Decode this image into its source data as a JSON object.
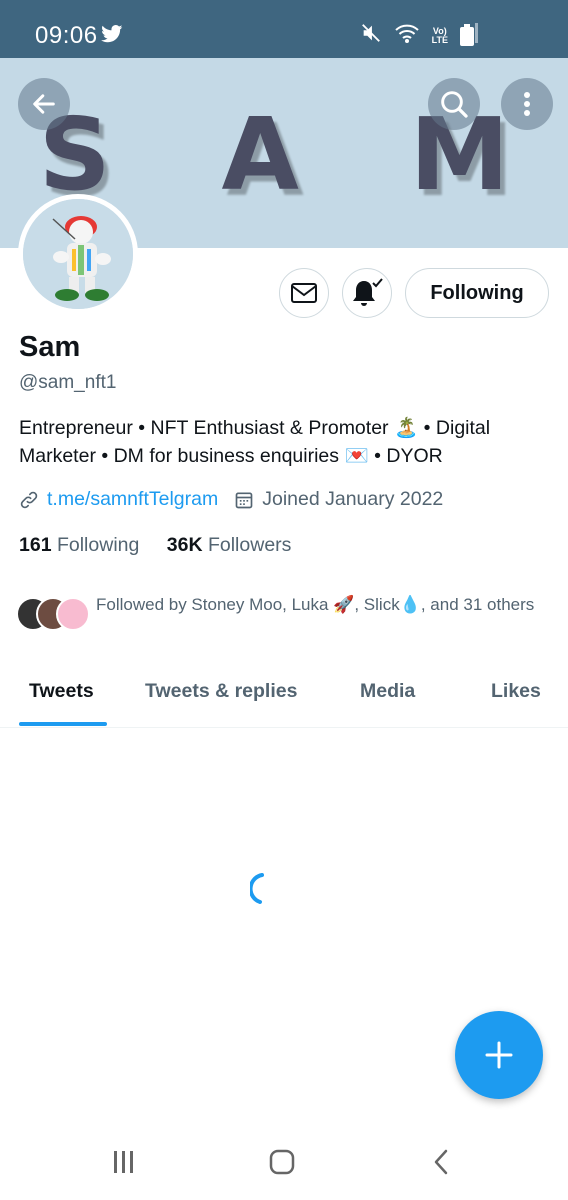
{
  "status_bar": {
    "time": "09:06",
    "lte_top": "Vo)",
    "lte_bottom": "LTE"
  },
  "banner": {
    "text": "S A M"
  },
  "profile": {
    "name": "Sam",
    "handle": "@sam_nft1",
    "bio": "Entrepreneur • NFT Enthusiast & Promoter 🏝️ • Digital Marketer • DM for business enquiries 💌 • DYOR",
    "link": "t.me/samnftTelgram",
    "joined": "Joined January 2022",
    "following_count": "161",
    "following_label": "Following",
    "followers_count": "36K",
    "followers_label": "Followers",
    "followed_by": "Followed by Stoney  Moo, Luka 🚀, Slick💧, and 31 others"
  },
  "actions": {
    "following_label": "Following"
  },
  "tabs": [
    {
      "label": "Tweets"
    },
    {
      "label": "Tweets & replies"
    },
    {
      "label": "Media"
    },
    {
      "label": "Likes"
    }
  ],
  "colors": {
    "accent": "#1d9bf0",
    "status_bar": "#3f6680",
    "banner": "#c4d9e6"
  },
  "icons": {
    "back": "arrow-left-icon",
    "search": "search-icon",
    "more": "more-vertical-icon",
    "message": "mail-icon",
    "notify": "bell-check-icon",
    "link": "link-icon",
    "calendar": "calendar-icon",
    "compose": "plus-icon"
  }
}
